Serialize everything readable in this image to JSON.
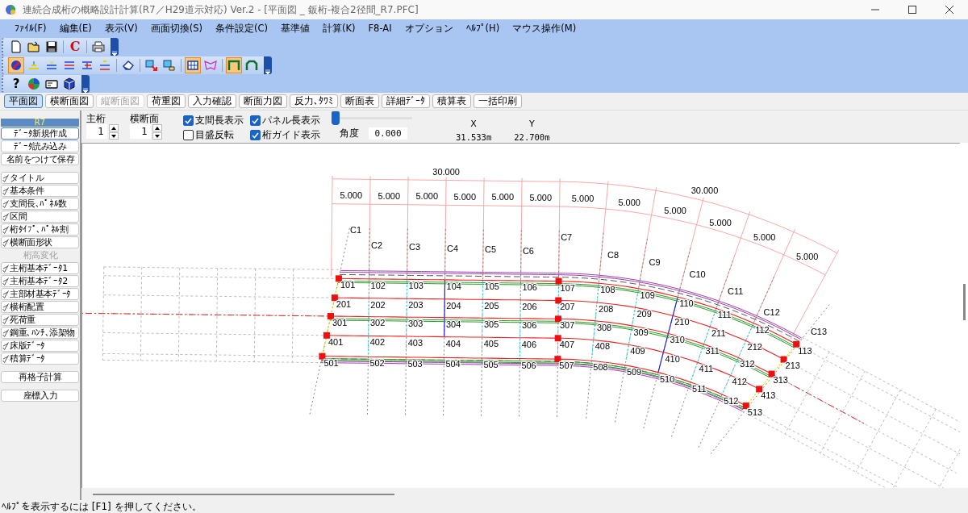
{
  "window": {
    "title": "連続合成桁の概略設計計算(R7／H29道示対応) Ver.2 - [平面図 _ 鈑桁-複合2径間_R7.PFC]"
  },
  "menu": [
    "ﾌｧｲﾙ(F)",
    "編集(E)",
    "表示(V)",
    "画面切換(S)",
    "条件設定(C)",
    "基準値",
    "計算(K)",
    "F8-AI",
    "オプション",
    "ﾍﾙﾌﾟ(H)",
    "マウス操作(M)"
  ],
  "toolbars": [
    {
      "buttons": [
        {
          "kind": "new"
        },
        {
          "kind": "open"
        },
        {
          "kind": "save"
        },
        {
          "kind": "sep"
        },
        {
          "kind": "text",
          "label": "C"
        },
        {
          "kind": "sep"
        },
        {
          "kind": "print"
        }
      ]
    },
    {
      "buttons": [
        {
          "kind": "node",
          "selected": true
        },
        {
          "kind": "guide1",
          "selected": false
        },
        {
          "kind": "guide2",
          "selected": false
        },
        {
          "kind": "guide3",
          "selected": false
        },
        {
          "kind": "guide4",
          "selected": false
        },
        {
          "kind": "guide5",
          "selected": false
        },
        {
          "kind": "sep"
        },
        {
          "kind": "eraser",
          "selected": false
        },
        {
          "kind": "sep"
        },
        {
          "kind": "export",
          "selected": false
        },
        {
          "kind": "import",
          "selected": false
        },
        {
          "kind": "sep"
        },
        {
          "kind": "grid",
          "selected": true
        },
        {
          "kind": "wing",
          "selected": false
        },
        {
          "kind": "sep"
        },
        {
          "kind": "frame",
          "selected": true
        },
        {
          "kind": "arch",
          "selected": false
        }
      ]
    },
    {
      "buttons": [
        {
          "kind": "text",
          "label": "?"
        },
        {
          "kind": "globe"
        },
        {
          "kind": "card"
        },
        {
          "kind": "cube"
        }
      ]
    }
  ],
  "view_tabs": [
    {
      "label": "平面図",
      "selected": true,
      "disabled": false
    },
    {
      "label": "横断面図",
      "selected": false,
      "disabled": false
    },
    {
      "label": "縦断面図",
      "selected": false,
      "disabled": true
    },
    {
      "label": "荷重図",
      "selected": false,
      "disabled": false
    },
    {
      "label": "入力確認",
      "selected": false,
      "disabled": false
    },
    {
      "label": "断面力図",
      "selected": false,
      "disabled": false
    },
    {
      "label": "反力､ﾀﾜﾐ",
      "selected": false,
      "disabled": false
    },
    {
      "label": "断面表",
      "selected": false,
      "disabled": false
    },
    {
      "label": "詳細ﾃﾞｰﾀ",
      "selected": false,
      "disabled": false
    },
    {
      "label": "積算表",
      "selected": false,
      "disabled": false
    },
    {
      "label": "一括印刷",
      "selected": false,
      "disabled": false
    }
  ],
  "sidebar": {
    "header": "R7",
    "sections": [
      [
        {
          "label": "ﾃﾞｰﾀ新規作成",
          "done": false,
          "disabled": false,
          "selected": true
        },
        {
          "label": "ﾃﾞｰﾀ読み込み",
          "done": false,
          "disabled": false,
          "selected": false
        },
        {
          "label": "名前をつけて保存",
          "done": false,
          "disabled": false,
          "selected": false
        }
      ],
      [
        {
          "label": "タイトル",
          "done": true,
          "disabled": false,
          "selected": false
        },
        {
          "label": "基本条件",
          "done": true,
          "disabled": false,
          "selected": false
        },
        {
          "label": "支間長､ﾊﾟﾈﾙ数",
          "done": true,
          "disabled": false,
          "selected": false
        },
        {
          "label": "区間",
          "done": true,
          "disabled": false,
          "selected": false
        },
        {
          "label": "桁ﾀｲﾌﾟ､ﾊﾟﾈﾙ割",
          "done": true,
          "disabled": false,
          "selected": false
        },
        {
          "label": "横断面形状",
          "done": true,
          "disabled": false,
          "selected": false
        },
        {
          "label": "桁高変化",
          "done": false,
          "disabled": true,
          "selected": false
        },
        {
          "label": "主桁基本ﾃﾞｰﾀ1",
          "done": true,
          "disabled": false,
          "selected": false
        },
        {
          "label": "主桁基本ﾃﾞｰﾀ2",
          "done": true,
          "disabled": false,
          "selected": false
        },
        {
          "label": "主部材基本ﾃﾞｰﾀ",
          "done": true,
          "disabled": false,
          "selected": false
        },
        {
          "label": "横桁配置",
          "done": true,
          "disabled": false,
          "selected": false
        },
        {
          "label": "死荷重",
          "done": true,
          "disabled": false,
          "selected": false
        },
        {
          "label": "鋼重､ﾊﾝﾁ､添架物",
          "done": true,
          "disabled": false,
          "selected": false
        },
        {
          "label": "床版ﾃﾞｰﾀ",
          "done": true,
          "disabled": false,
          "selected": false
        },
        {
          "label": "積算ﾃﾞｰﾀ",
          "done": true,
          "disabled": false,
          "selected": false
        }
      ],
      [
        {
          "label": "再格子計算",
          "done": false,
          "disabled": false,
          "selected": false
        }
      ],
      [
        {
          "label": "座標入力",
          "done": false,
          "disabled": false,
          "selected": false
        }
      ]
    ]
  },
  "spinners": [
    {
      "label": "主桁",
      "value": "1"
    },
    {
      "label": "横断面",
      "value": "1"
    }
  ],
  "checkboxes": [
    {
      "label": "支間長表示",
      "checked": true
    },
    {
      "label": "パネル長表示",
      "checked": true
    },
    {
      "label": "目盛反転",
      "checked": false
    },
    {
      "label": "桁ガイド表示",
      "checked": true
    }
  ],
  "slider": {
    "level": 0
  },
  "angle": {
    "label": "角度",
    "value": "0.000"
  },
  "coords": {
    "x_label": "X",
    "x_value": "31.533m",
    "y_label": "Y",
    "y_value": "22.700m"
  },
  "drawing": {
    "total_labels": [
      "30.000",
      "30.000"
    ],
    "panel_labels": [
      "5.000",
      "5.000",
      "5.000",
      "5.000",
      "5.000",
      "5.000",
      "5.000",
      "5.000",
      "5.000",
      "5.000",
      "5.000",
      "5.000"
    ],
    "cross_beams": [
      "C1",
      "C2",
      "C3",
      "C4",
      "C5",
      "C6",
      "C7",
      "C8",
      "C9",
      "C10",
      "C11",
      "C12",
      "C13"
    ],
    "girders": [
      [
        "101",
        "102",
        "103",
        "104",
        "105",
        "106",
        "107",
        "108",
        "109",
        "110",
        "111",
        "112",
        "113"
      ],
      [
        "201",
        "202",
        "203",
        "204",
        "205",
        "206",
        "207",
        "208",
        "209",
        "210",
        "211",
        "212",
        "213"
      ],
      [
        "301",
        "302",
        "303",
        "304",
        "305",
        "306",
        "307",
        "308",
        "309",
        "310",
        "311",
        "312",
        "313"
      ],
      [
        "401",
        "402",
        "403",
        "404",
        "405",
        "406",
        "407",
        "408",
        "409",
        "410",
        "411",
        "412",
        "413"
      ],
      [
        "501",
        "502",
        "503",
        "504",
        "505",
        "506",
        "507",
        "508",
        "509",
        "510",
        "511",
        "512",
        "513"
      ]
    ]
  },
  "status_bar": "ﾍﾙﾌﾟを表示するには [F1] を押してください。"
}
